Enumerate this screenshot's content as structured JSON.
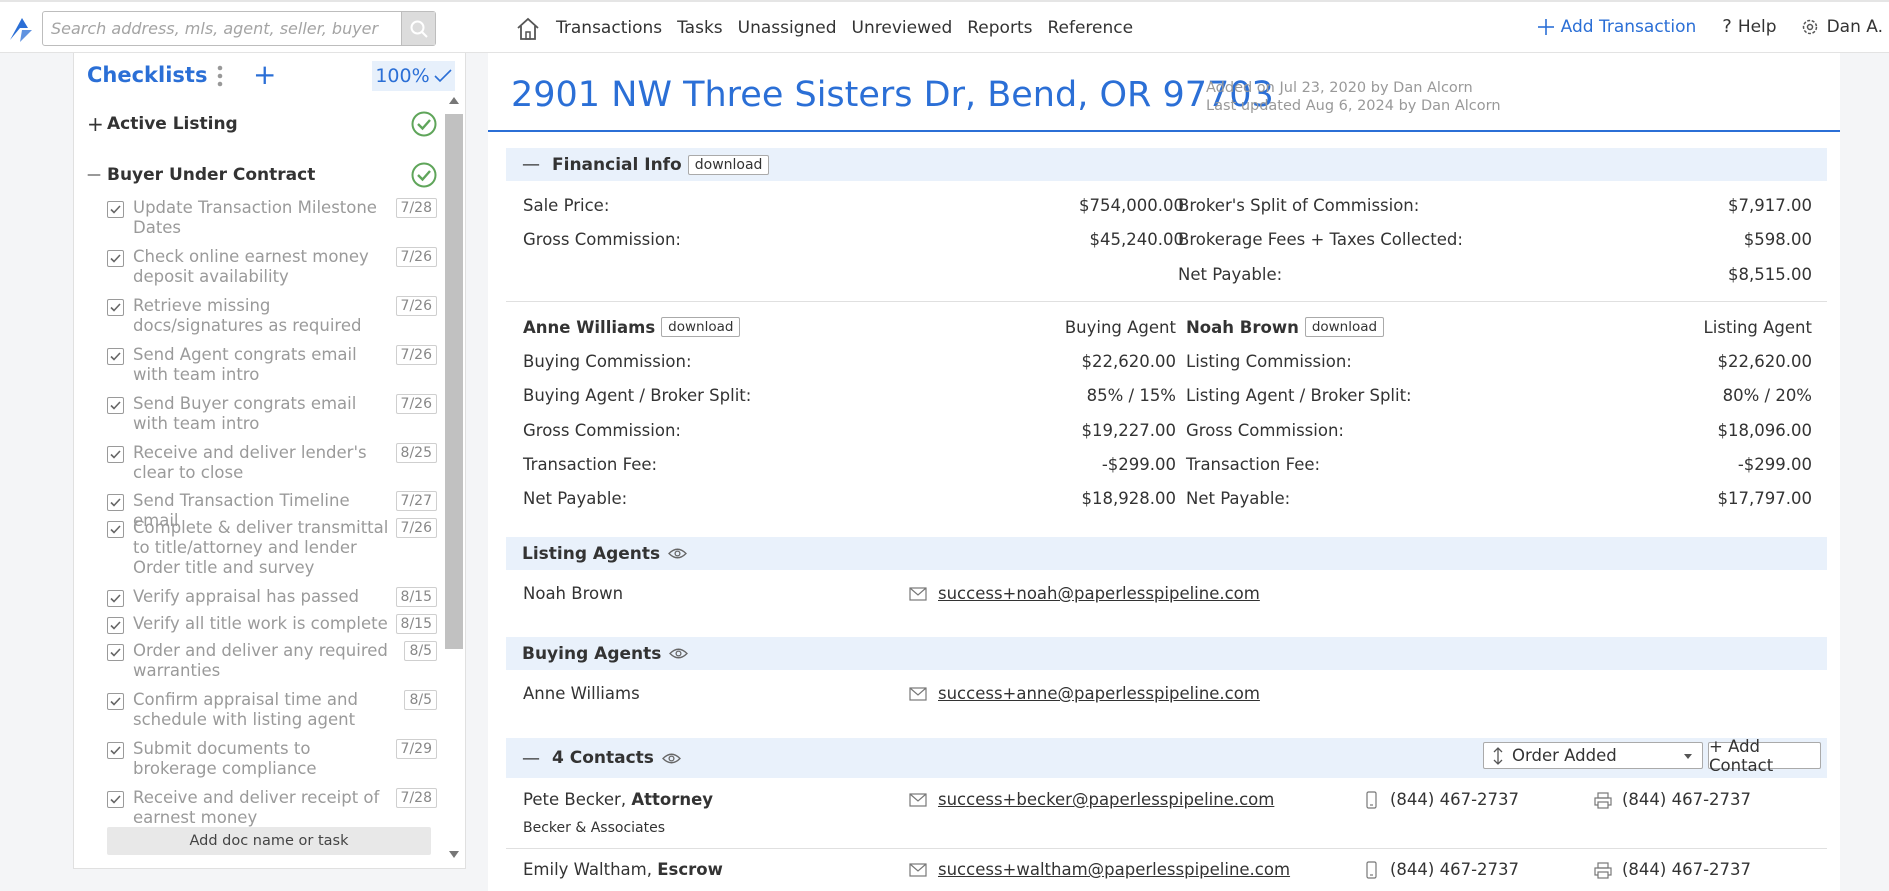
{
  "topbar": {
    "search_placeholder": "Search address, mls, agent, seller, buyer",
    "nav": [
      "Transactions",
      "Tasks",
      "Unassigned",
      "Unreviewed",
      "Reports",
      "Reference"
    ],
    "add_transaction": "Add Transaction",
    "help": "Help",
    "user": "Dan A."
  },
  "checklists": {
    "title": "Checklists",
    "percent": "100%",
    "groups": [
      {
        "sign": "+",
        "label": "Active Listing"
      },
      {
        "sign": "—",
        "label": "Buyer Under Contract"
      }
    ],
    "tasks": [
      {
        "label": "Update Transaction Milestone Dates",
        "date": "7/28"
      },
      {
        "label": "Check online earnest money deposit availability",
        "date": "7/26"
      },
      {
        "label": "Retrieve missing docs/signatures as required",
        "date": "7/26"
      },
      {
        "label": "Send Agent congrats email with team intro",
        "date": "7/26"
      },
      {
        "label": "Send Buyer congrats email with team intro",
        "date": "7/26"
      },
      {
        "label": "Receive and deliver lender's clear to close",
        "date": "8/25"
      },
      {
        "label": "Send Transaction Timeline email",
        "date": "7/27"
      },
      {
        "label": "Complete & deliver transmittal to title/attorney and lender Order title and survey",
        "date": "7/26"
      },
      {
        "label": "Verify appraisal has passed",
        "date": "8/15"
      },
      {
        "label": "Verify all title work is complete",
        "date": "8/15"
      },
      {
        "label": "Order and deliver any required warranties",
        "date": "8/5"
      },
      {
        "label": "Confirm appraisal time and schedule with listing agent",
        "date": "8/5"
      },
      {
        "label": "Submit documents to brokerage compliance",
        "date": "7/29"
      },
      {
        "label": "Receive and deliver receipt of earnest money",
        "date": "7/28"
      }
    ],
    "add_doc": "Add doc name or task"
  },
  "transaction": {
    "address": "2901 NW Three Sisters Dr, Bend, OR 97703",
    "added": "Added on Jul 23, 2020 by Dan Alcorn",
    "updated": "Last updated Aug 6, 2024 by Dan Alcorn"
  },
  "financial": {
    "title": "Financial Info",
    "download": "download",
    "left": [
      {
        "label": "Sale Price:",
        "value": "$754,000.00"
      },
      {
        "label": "Gross Commission:",
        "value": "$45,240.00"
      }
    ],
    "right": [
      {
        "label": "Broker's Split of Commission:",
        "value": "$7,917.00"
      },
      {
        "label": "Brokerage Fees + Taxes Collected:",
        "value": "$598.00"
      },
      {
        "label": "Net Payable:",
        "value": "$8,515.00"
      }
    ],
    "buying": {
      "name": "Anne Williams",
      "role": "Buying Agent",
      "rows": [
        {
          "label": "Buying Commission:",
          "value": "$22,620.00"
        },
        {
          "label": "Buying Agent / Broker Split:",
          "value": "85% / 15%"
        },
        {
          "label": "Gross Commission:",
          "value": "$19,227.00"
        },
        {
          "label": "Transaction Fee:",
          "value": "-$299.00"
        },
        {
          "label": "Net Payable:",
          "value": "$18,928.00"
        }
      ]
    },
    "listing": {
      "name": "Noah Brown",
      "role": "Listing Agent",
      "rows": [
        {
          "label": "Listing Commission:",
          "value": "$22,620.00"
        },
        {
          "label": "Listing Agent / Broker Split:",
          "value": "80% / 20%"
        },
        {
          "label": "Gross Commission:",
          "value": "$18,096.00"
        },
        {
          "label": "Transaction Fee:",
          "value": "-$299.00"
        },
        {
          "label": "Net Payable:",
          "value": "$17,797.00"
        }
      ]
    }
  },
  "listing_agents": {
    "title": "Listing Agents",
    "name": "Noah Brown",
    "email": "success+noah@paperlesspipeline.com"
  },
  "buying_agents": {
    "title": "Buying Agents",
    "name": "Anne Williams",
    "email": "success+anne@paperlesspipeline.com"
  },
  "contacts": {
    "title": "4 Contacts",
    "order": "Order Added",
    "add": "+ Add Contact",
    "list": [
      {
        "name": "Pete Becker,",
        "role": "Attorney",
        "company": "Becker & Associates",
        "email": "success+becker@paperlesspipeline.com",
        "phone": "(844) 467-2737",
        "fax": "(844) 467-2737"
      },
      {
        "name": "Emily Waltham,",
        "role": "Escrow",
        "email": "success+waltham@paperlesspipeline.com",
        "phone": "(844) 467-2737",
        "fax": "(844) 467-2737"
      }
    ]
  },
  "colors": {
    "accent": "#2b6fd6",
    "check": "#5fa55a",
    "section_bg": "#e9f1fb"
  }
}
